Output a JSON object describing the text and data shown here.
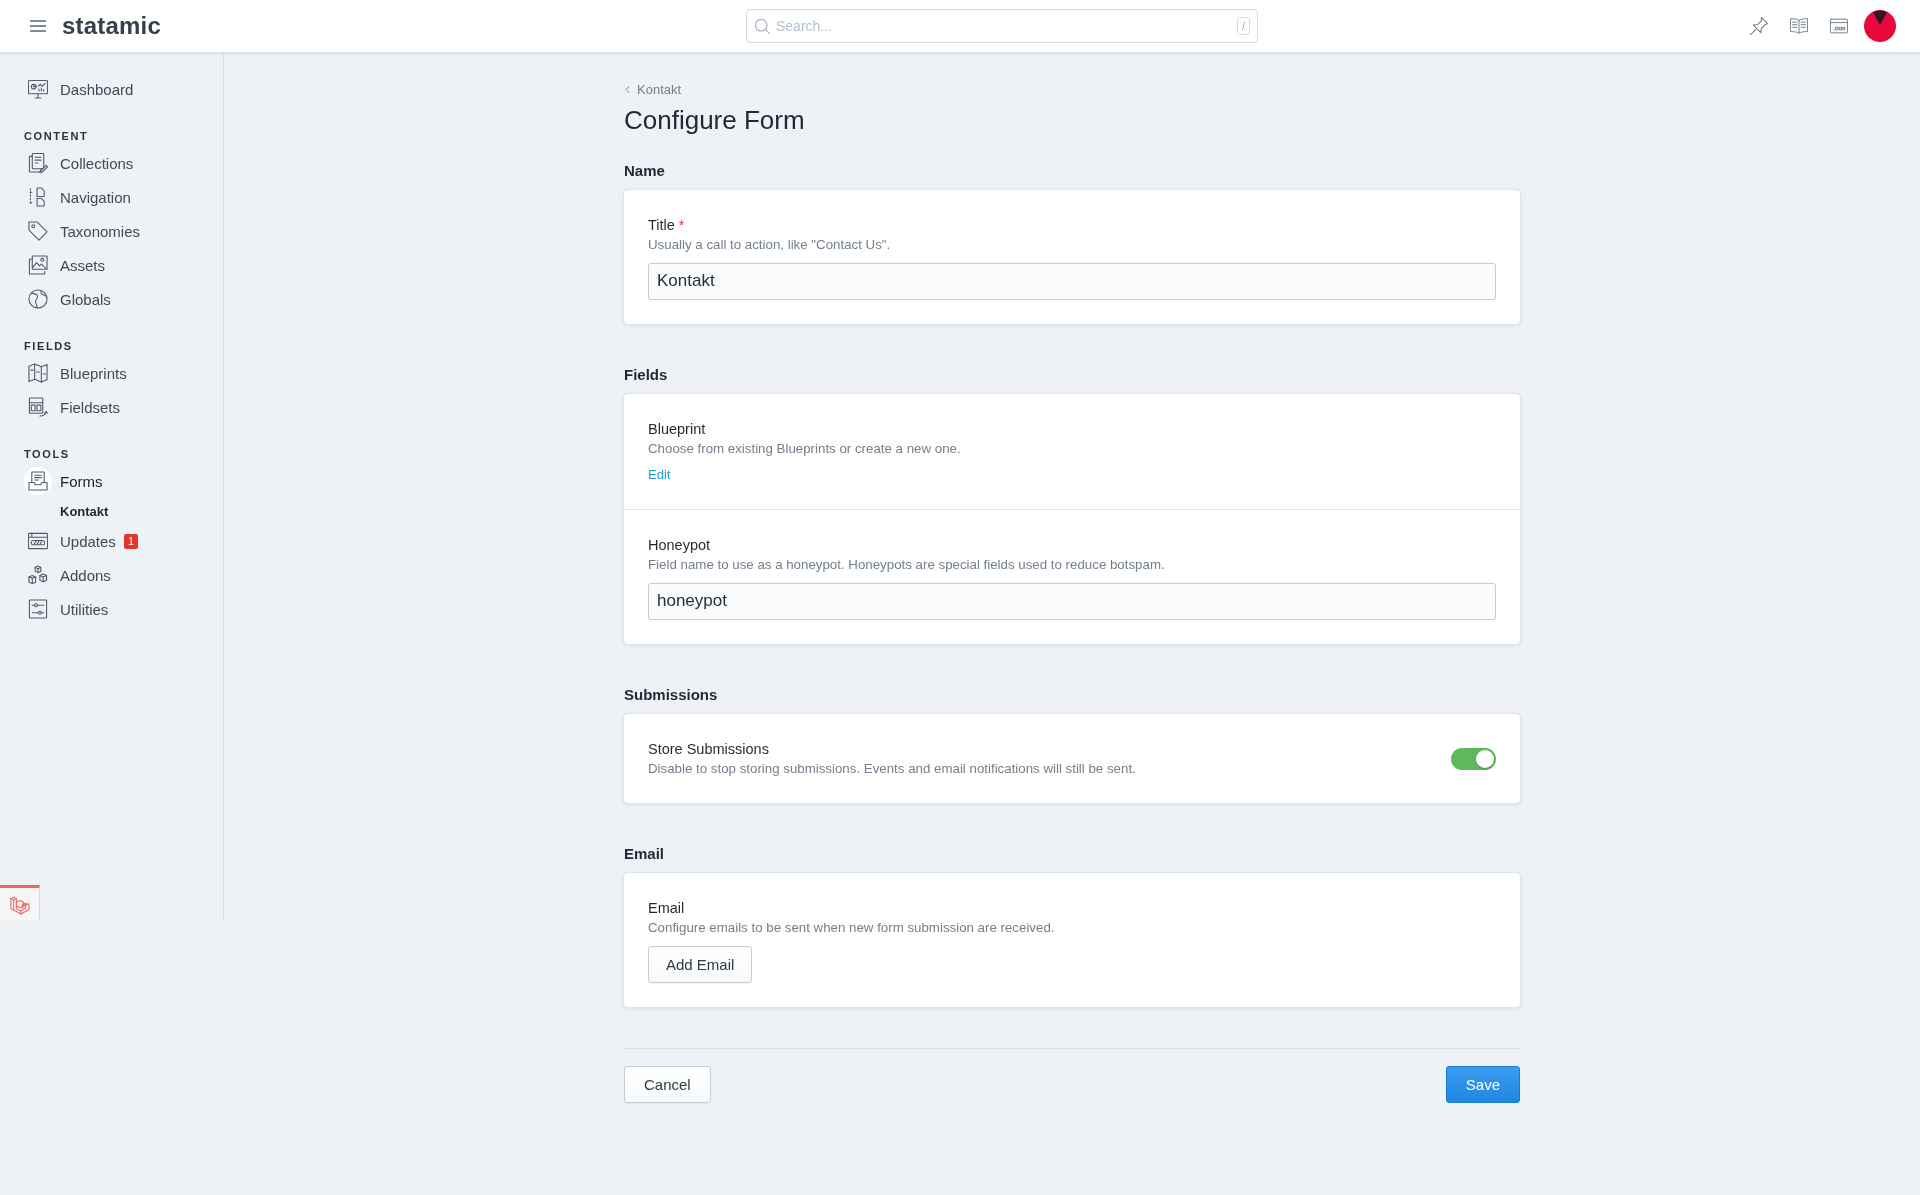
{
  "topbar": {
    "logo": "statamic",
    "search": {
      "placeholder": "Search...",
      "shortcut": "/"
    }
  },
  "sidebar": {
    "sections": [
      {
        "items": [
          {
            "label": "Dashboard",
            "selected": false
          }
        ]
      },
      {
        "heading": "CONTENT",
        "items": [
          {
            "label": "Collections",
            "selected": false
          },
          {
            "label": "Navigation",
            "selected": false
          },
          {
            "label": "Taxonomies",
            "selected": false
          },
          {
            "label": "Assets",
            "selected": false
          },
          {
            "label": "Globals",
            "selected": false
          }
        ]
      },
      {
        "heading": "FIELDS",
        "items": [
          {
            "label": "Blueprints",
            "selected": false
          },
          {
            "label": "Fieldsets",
            "selected": false
          }
        ]
      },
      {
        "heading": "TOOLS",
        "items": [
          {
            "label": "Forms",
            "selected": true,
            "children": [
              {
                "label": "Kontakt",
                "selected": true
              }
            ]
          },
          {
            "label": "Updates",
            "selected": false,
            "badge": "1"
          },
          {
            "label": "Addons",
            "selected": false
          },
          {
            "label": "Utilities",
            "selected": false
          }
        ]
      }
    ]
  },
  "breadcrumb": {
    "label": "Kontakt"
  },
  "page_title": "Configure Form",
  "sections": [
    {
      "heading": "Name",
      "fields": [
        {
          "kind": "text",
          "label": "Title",
          "marker": "*",
          "help": "Usually a call to action, like \"Contact Us\".",
          "value": "Kontakt"
        }
      ]
    },
    {
      "heading": "Fields",
      "fields": [
        {
          "kind": "link",
          "label": "Blueprint",
          "help": "Choose from existing Blueprints or create a new one.",
          "link": "Edit"
        },
        {
          "kind": "text",
          "label": "Honeypot",
          "help": "Field name to use as a honeypot. Honeypots are special fields used to reduce botspam.",
          "value": "honeypot"
        }
      ]
    },
    {
      "heading": "Submissions",
      "fields": [
        {
          "kind": "toggle",
          "label": "Store Submissions",
          "help": "Disable to stop storing submissions. Events and email notifications will still be sent.",
          "on": true
        }
      ]
    },
    {
      "heading": "Email",
      "fields": [
        {
          "kind": "button",
          "label": "Email",
          "help": "Configure emails to be sent when new form submission are received.",
          "button": "Add Email"
        }
      ]
    }
  ],
  "footer": {
    "buttons": [
      {
        "label": "Cancel",
        "kind": "secondary"
      },
      {
        "label": "Save",
        "kind": "primary"
      }
    ]
  }
}
